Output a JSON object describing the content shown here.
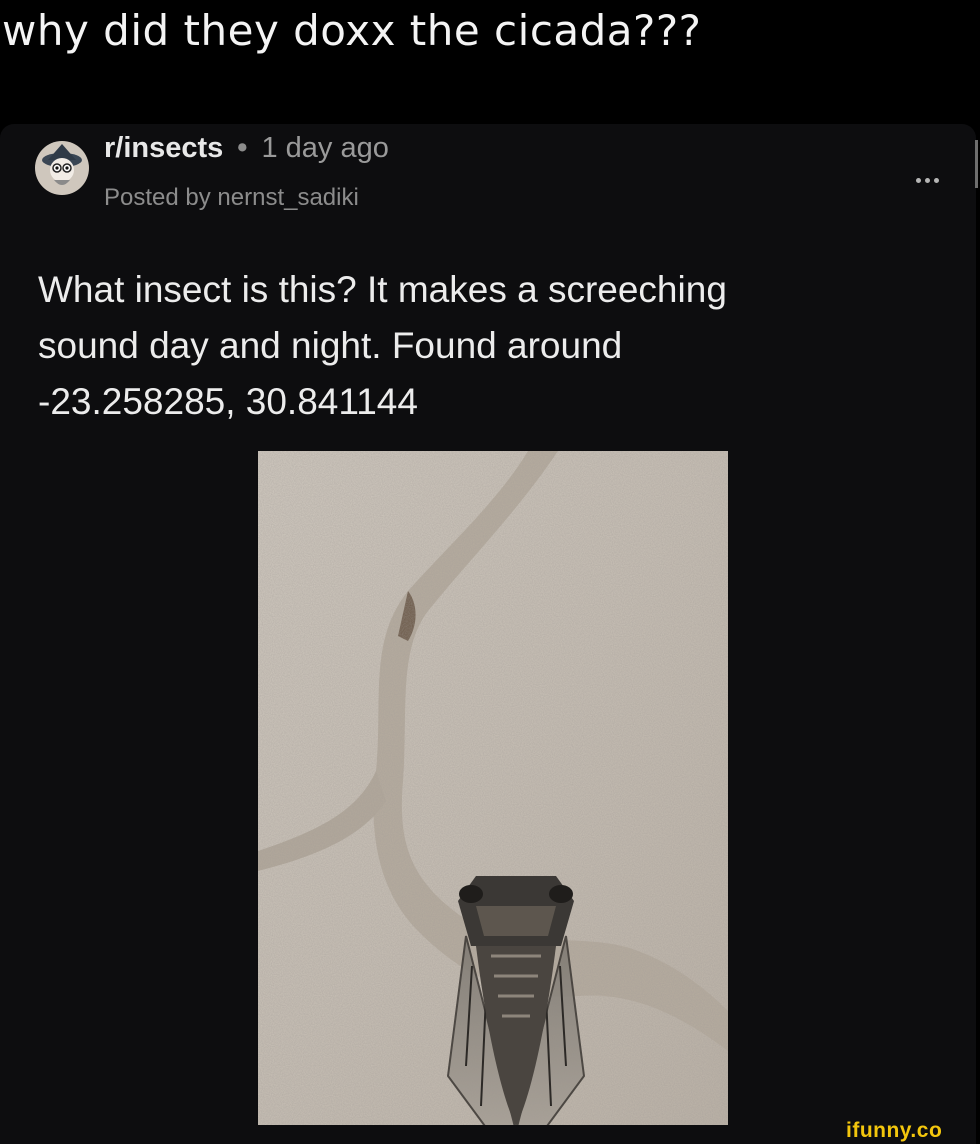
{
  "caption": "why did they doxx the cicada???",
  "post": {
    "subreddit": "r/insects",
    "separator": "•",
    "age": "1 day ago",
    "posted_by": "Posted by nernst_sadiki",
    "title_lines": [
      "What insect is this? It makes a screeching",
      "sound day and night. Found around",
      "-23.258285, 30.841144"
    ]
  },
  "icons": {
    "more": "more-horizontal-icon",
    "avatar": "subreddit-avatar"
  },
  "watermark": "ifunny.co",
  "colors": {
    "background": "#000000",
    "card": "#0d0d0f",
    "watermark": "#f3c60d"
  }
}
